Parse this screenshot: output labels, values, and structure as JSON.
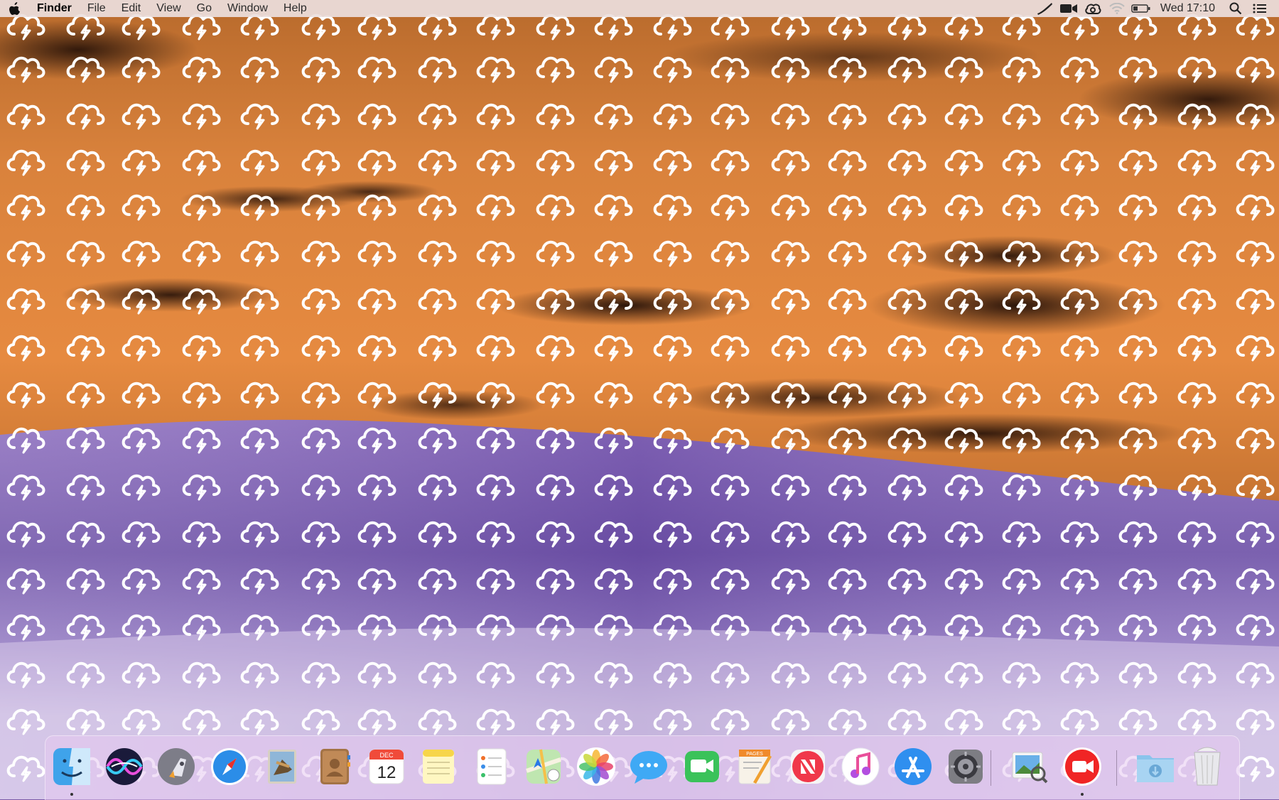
{
  "menubar": {
    "apple_icon": "apple-logo-icon",
    "app_name": "Finder",
    "menus": [
      "File",
      "Edit",
      "View",
      "Go",
      "Window",
      "Help"
    ],
    "status_icons": [
      "pen-tablet-icon",
      "screen-recording-icon",
      "creative-cloud-icon",
      "wifi-icon",
      "battery-icon"
    ],
    "clock": "Wed 17:10",
    "right_icons": [
      "spotlight-search-icon",
      "notification-center-icon"
    ]
  },
  "desktop": {
    "wallpaper": "inverted-sky-and-hills",
    "pattern_icon": "cloud-lightning-icon",
    "colors": {
      "sky": "#e08a3e",
      "hills": "#7d5bb0",
      "cloud_outline": "#ffffff"
    }
  },
  "dock": {
    "apps": [
      {
        "name": "Finder",
        "icon": "finder-icon",
        "running": true
      },
      {
        "name": "Siri",
        "icon": "siri-icon",
        "running": false
      },
      {
        "name": "Launchpad",
        "icon": "launchpad-icon",
        "running": false
      },
      {
        "name": "Safari",
        "icon": "safari-icon",
        "running": false
      },
      {
        "name": "Mail",
        "icon": "mail-icon",
        "running": false
      },
      {
        "name": "Contacts",
        "icon": "contacts-icon",
        "running": false
      },
      {
        "name": "Calendar",
        "icon": "calendar-icon",
        "running": false,
        "month": "DEC",
        "day": "12"
      },
      {
        "name": "Notes",
        "icon": "notes-icon",
        "running": false
      },
      {
        "name": "Reminders",
        "icon": "reminders-icon",
        "running": false
      },
      {
        "name": "Maps",
        "icon": "maps-icon",
        "running": false
      },
      {
        "name": "Photos",
        "icon": "photos-icon",
        "running": false
      },
      {
        "name": "Messages",
        "icon": "messages-icon",
        "running": false
      },
      {
        "name": "FaceTime",
        "icon": "facetime-icon",
        "running": false
      },
      {
        "name": "Pages",
        "icon": "pages-icon",
        "running": false,
        "label": "PAGES"
      },
      {
        "name": "News",
        "icon": "news-icon",
        "running": false
      },
      {
        "name": "Music",
        "icon": "music-icon",
        "running": false
      },
      {
        "name": "App Store",
        "icon": "app-store-icon",
        "running": false
      },
      {
        "name": "System Preferences",
        "icon": "system-preferences-icon",
        "running": false
      },
      {
        "name": "Preview",
        "icon": "preview-icon",
        "running": false
      },
      {
        "name": "Screen Recorder",
        "icon": "video-recorder-icon",
        "running": true
      },
      {
        "name": "Downloads",
        "icon": "downloads-folder-icon",
        "running": false
      },
      {
        "name": "Trash",
        "icon": "trash-icon",
        "running": false
      }
    ]
  }
}
